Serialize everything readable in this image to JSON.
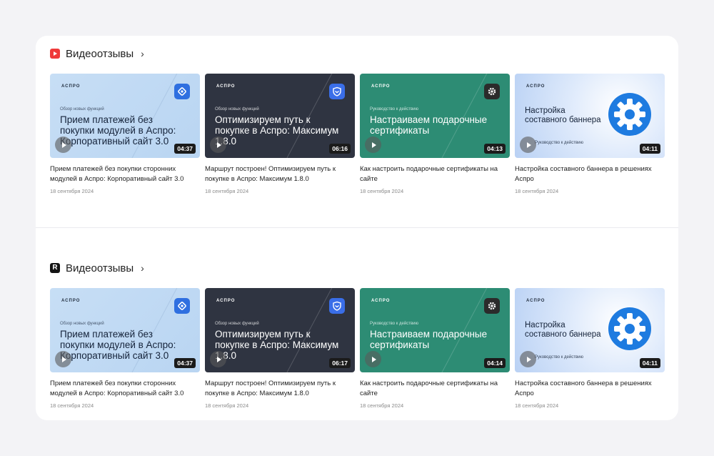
{
  "colors": {
    "rutube_red": "#ef3a3a",
    "dark_card": "#2f3441",
    "green_card": "#2d8c74",
    "light_card": "#c7def5"
  },
  "sections": [
    {
      "title": "Видеоотзывы",
      "icon": "rutube-icon",
      "chevron": "›",
      "cards": [
        {
          "brand": "АСПРО",
          "kicker": "Обзор новых функций",
          "headline": "Прием платежей без покупки модулей в Аспро: Корпоративный сайт 3.0",
          "duration": "04:37",
          "title": "Прием платежей без покупки сторонних модулей в Аспро: Корпоративный сайт 3.0",
          "date": "18 сентября 2024"
        },
        {
          "brand": "АСПРО",
          "kicker": "Обзор новых функций",
          "headline": "Оптимизируем путь к покупке в Аспро: Максимум 1.8.0",
          "duration": "06:16",
          "title": "Маршрут построен! Оптимизируем путь к покупке в Аспро: Максимум 1.8.0",
          "date": "18 сентября 2024"
        },
        {
          "brand": "АСПРО",
          "kicker": "Руководство к действию",
          "headline": "Настраиваем подарочные сертификаты",
          "duration": "04:13",
          "title": "Как настроить подарочные сертификаты на сайте",
          "date": "18 сентября 2024"
        },
        {
          "brand": "АСПРО",
          "kicker": "Руководство к действию",
          "headline": "Настройка составного баннера",
          "duration": "04:11",
          "title": "Настройка составного баннера в решениях Аспро",
          "date": "18 сентября 2024"
        }
      ]
    },
    {
      "title": "Видеоотзывы",
      "icon": "r-logo-icon",
      "icon_letter": "R",
      "chevron": "›",
      "cards": [
        {
          "brand": "АСПРО",
          "kicker": "Обзор новых функций",
          "headline": "Прием платежей без покупки модулей в Аспро: Корпоративный сайт 3.0",
          "duration": "04:37",
          "title": "Прием платежей без покупки сторонних модулей в Аспро: Корпоративный сайт 3.0",
          "date": "18 сентября 2024"
        },
        {
          "brand": "АСПРО",
          "kicker": "Обзор новых функций",
          "headline": "Оптимизируем путь к покупке в Аспро: Максимум 1.8.0",
          "duration": "06:17",
          "title": "Маршрут построен! Оптимизируем путь к покупке в Аспро: Максимум 1.8.0",
          "date": "18 сентября 2024"
        },
        {
          "brand": "АСПРО",
          "kicker": "Руководство к действию",
          "headline": "Настраиваем подарочные сертификаты",
          "duration": "04:14",
          "title": "Как настроить подарочные сертификаты на сайте",
          "date": "18 сентября 2024"
        },
        {
          "brand": "АСПРО",
          "kicker": "Руководство к действию",
          "headline": "Настройка составного баннера",
          "duration": "04:11",
          "title": "Настройка составного баннера в решениях Аспро",
          "date": "18 сентября 2024"
        }
      ]
    }
  ]
}
